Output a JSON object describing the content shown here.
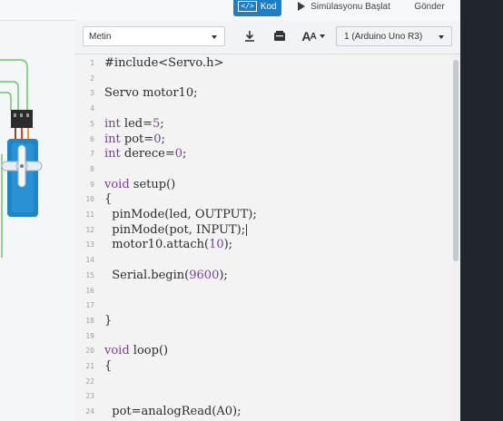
{
  "topbar": {
    "code_button": "Kod",
    "code_icon": "code-bracket-icon",
    "simulate_button": "Simülasyonu Başlat",
    "send_button": "Gönder"
  },
  "editor_toolbar": {
    "mode_select": "Metin",
    "download_icon": "download-icon",
    "library_icon": "library-icon",
    "font_size_label": "A",
    "font_size_small": "A",
    "board_select": "1 (Arduino Uno R3)"
  },
  "colors": {
    "accent": "#1f7fc4",
    "keyword": "#7a3f9a",
    "wire": "#6cc96b",
    "servo": "#1e86c8"
  },
  "code": [
    {
      "n": "1",
      "t": "#include<Servo.h>"
    },
    {
      "n": "2",
      "t": ""
    },
    {
      "n": "3",
      "t": "Servo motor10;"
    },
    {
      "n": "4",
      "t": ""
    },
    {
      "n": "5",
      "t": "int led=5;"
    },
    {
      "n": "6",
      "t": "int pot=0;"
    },
    {
      "n": "7",
      "t": "int derece=0;"
    },
    {
      "n": "8",
      "t": ""
    },
    {
      "n": "9",
      "t": "void setup()"
    },
    {
      "n": "10",
      "t": "{"
    },
    {
      "n": "11",
      "t": "  pinMode(led, OUTPUT);"
    },
    {
      "n": "12",
      "t": "  pinMode(pot, INPUT);"
    },
    {
      "n": "13",
      "t": "  motor10.attach(10);"
    },
    {
      "n": "14",
      "t": ""
    },
    {
      "n": "15",
      "t": "  Serial.begin(9600);"
    },
    {
      "n": "16",
      "t": ""
    },
    {
      "n": "17",
      "t": ""
    },
    {
      "n": "18",
      "t": "}"
    },
    {
      "n": "19",
      "t": ""
    },
    {
      "n": "20",
      "t": "void loop()"
    },
    {
      "n": "21",
      "t": "{"
    },
    {
      "n": "22",
      "t": ""
    },
    {
      "n": "23",
      "t": ""
    },
    {
      "n": "24",
      "t": "  pot=analogRead(A0);"
    }
  ]
}
